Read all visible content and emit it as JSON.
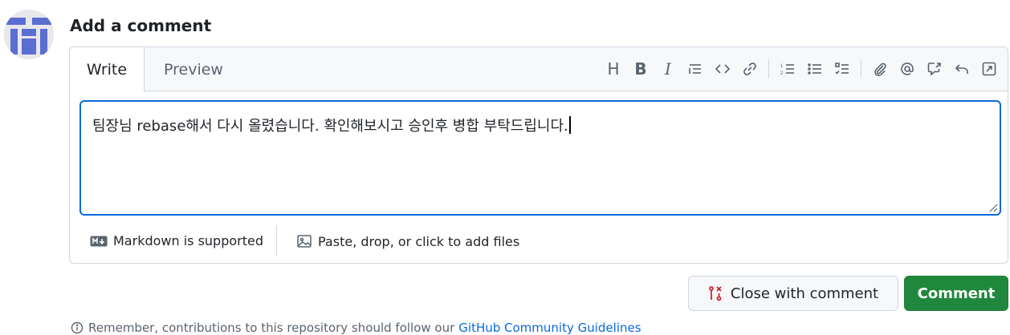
{
  "header": {
    "title": "Add a comment"
  },
  "tabs": {
    "write": "Write",
    "preview": "Preview"
  },
  "toolbar": {
    "heading": "H",
    "bold": "B",
    "italic": "I",
    "icons": [
      "heading-icon",
      "bold-icon",
      "italic-icon",
      "quote-icon",
      "code-icon",
      "link-icon",
      "ordered-list-icon",
      "unordered-list-icon",
      "task-list-icon",
      "paperclip-icon",
      "mention-icon",
      "cross-reference-icon",
      "reply-icon",
      "fullscreen-icon"
    ]
  },
  "editor": {
    "value": "팀장님 rebase해서 다시 올렸습니다. 확인해보시고 승인후 병합 부탁드립니다."
  },
  "footer": {
    "markdown_label": "Markdown is supported",
    "attach_label": "Paste, drop, or click to add files"
  },
  "buttons": {
    "close_with_comment": "Close with comment",
    "comment": "Comment"
  },
  "note": {
    "text": "Remember, contributions to this repository should follow our",
    "link": "GitHub Community Guidelines"
  },
  "colors": {
    "accent": "#0969da",
    "primary_button": "#1f883d",
    "close_icon": "#cf222e"
  }
}
